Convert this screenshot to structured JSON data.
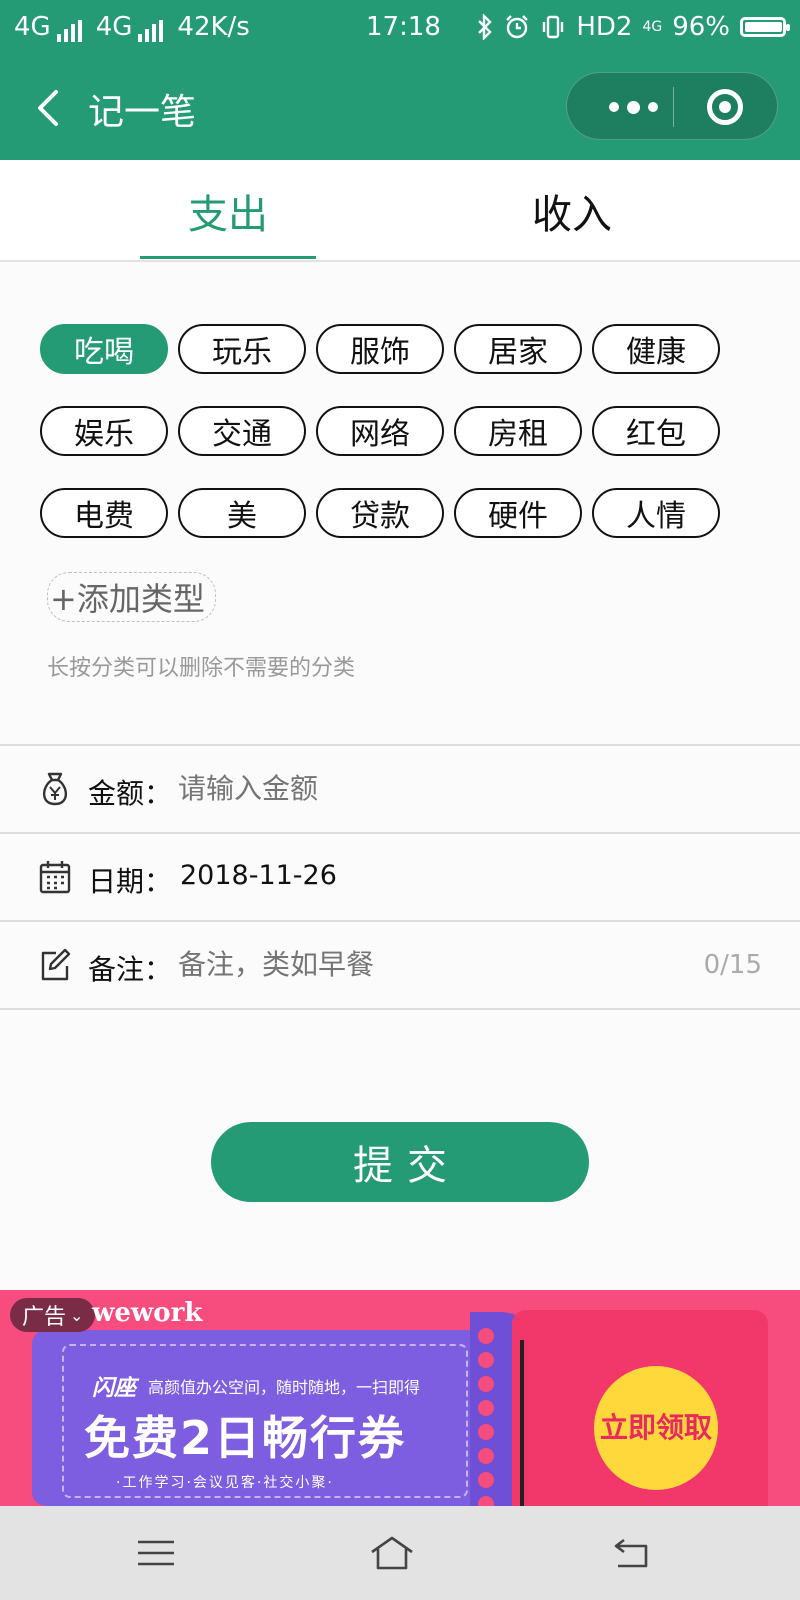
{
  "status_bar": {
    "network_1": "4G",
    "network_2": "4G",
    "speed": "42K/s",
    "time": "17:18",
    "hd": "HD2",
    "net_small": "4G",
    "battery": "96%"
  },
  "nav": {
    "title": "记一笔"
  },
  "tabs": {
    "expense": "支出",
    "income": "收入"
  },
  "categories": {
    "items": [
      "吃喝",
      "玩乐",
      "服饰",
      "居家",
      "健康",
      "娱乐",
      "交通",
      "网络",
      "房租",
      "红包",
      "电费",
      "美",
      "贷款",
      "硬件",
      "人情"
    ],
    "selected": "吃喝",
    "add_label": "+添加类型",
    "hint": "长按分类可以删除不需要的分类"
  },
  "form": {
    "amount_label": "金额：",
    "amount_placeholder": "请输入金额",
    "date_label": "日期：",
    "date_value": "2018-11-26",
    "note_label": "备注：",
    "note_placeholder": "备注，类如早餐",
    "note_counter": "0/15"
  },
  "submit_label": "提交",
  "ad": {
    "badge": "广告",
    "brand": "wework",
    "brand_cn": "闪座",
    "line1": "高颜值办公空间，随时随地，一扫即得",
    "line2": "免费2日畅行券",
    "line3": "·工作学习·会议见客·社交小聚·",
    "cta": "立即领取"
  },
  "colors": {
    "primary": "#249b74",
    "ad_pink": "#f64c7e",
    "ad_purple": "#7d5ee0",
    "cta_yellow": "#ffd93b"
  },
  "icons": {
    "back": "chevron-left-icon",
    "more": "more-dots-icon",
    "close": "target-icon",
    "amount": "money-bag-icon",
    "date": "calendar-icon",
    "note": "edit-icon"
  }
}
